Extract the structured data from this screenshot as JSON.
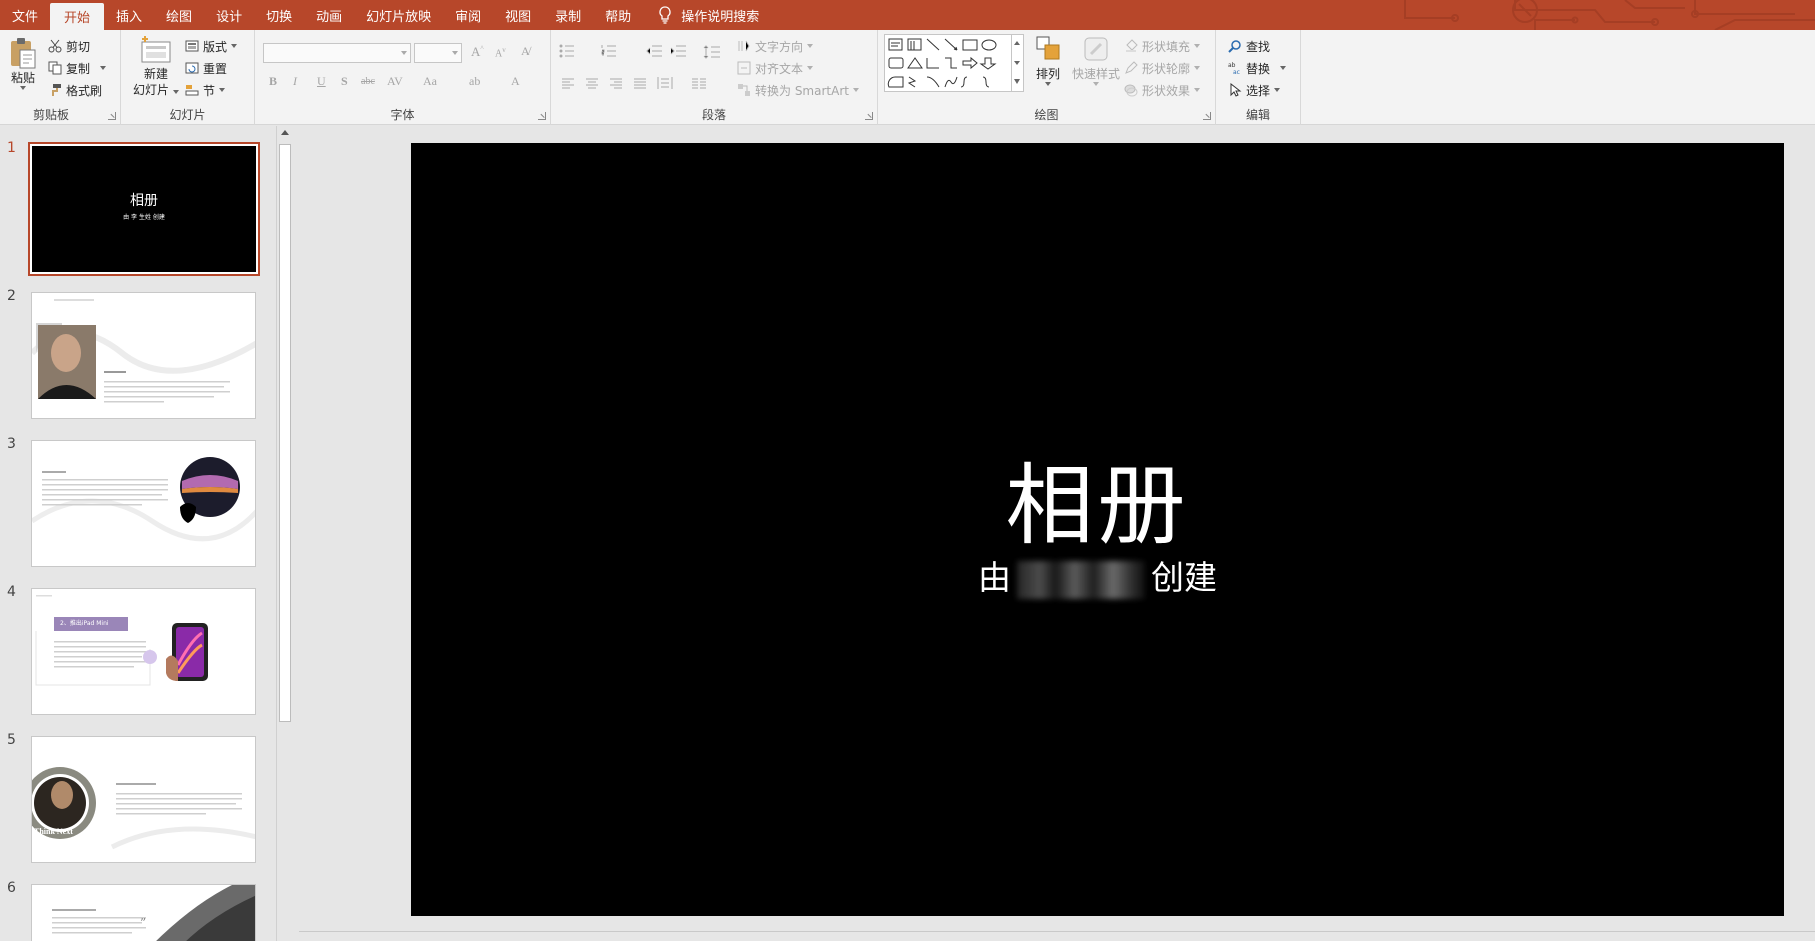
{
  "tabs": [
    {
      "label": "文件",
      "name": "tab-file"
    },
    {
      "label": "开始",
      "name": "tab-home",
      "active": true
    },
    {
      "label": "插入",
      "name": "tab-insert"
    },
    {
      "label": "绘图",
      "name": "tab-draw"
    },
    {
      "label": "设计",
      "name": "tab-design"
    },
    {
      "label": "切换",
      "name": "tab-transitions"
    },
    {
      "label": "动画",
      "name": "tab-animations"
    },
    {
      "label": "幻灯片放映",
      "name": "tab-slideshow"
    },
    {
      "label": "审阅",
      "name": "tab-review"
    },
    {
      "label": "视图",
      "name": "tab-view"
    },
    {
      "label": "录制",
      "name": "tab-record"
    },
    {
      "label": "帮助",
      "name": "tab-help"
    }
  ],
  "search_label": "操作说明搜索",
  "clipboard": {
    "label": "剪贴板",
    "paste": "粘贴",
    "cut": "剪切",
    "copy": "复制",
    "format_painter": "格式刷"
  },
  "slides_group": {
    "label": "幻灯片",
    "new_slide_1": "新建",
    "new_slide_2": "幻灯片",
    "layout": "版式",
    "reset": "重置",
    "section": "节"
  },
  "font_group": {
    "label": "字体"
  },
  "paragraph_group": {
    "label": "段落",
    "text_direction": "文字方向",
    "align_text": "对齐文本",
    "smartart": "转换为 SmartArt"
  },
  "drawing_group": {
    "label": "绘图",
    "arrange": "排列",
    "quick_styles": "快速样式",
    "shape_fill": "形状填充",
    "shape_outline": "形状轮廓",
    "shape_effects": "形状效果"
  },
  "editing_group": {
    "label": "编辑",
    "find": "查找",
    "replace": "替换",
    "select": "选择"
  },
  "thumbnails": [
    {
      "num": "1",
      "title": "相册",
      "sub": "由 李 生姓 创建"
    },
    {
      "num": "2"
    },
    {
      "num": "3"
    },
    {
      "num": "4",
      "chip": "2、推出iPad Mini"
    },
    {
      "num": "5",
      "badge": "Think Next"
    },
    {
      "num": "6"
    }
  ],
  "slide": {
    "title": "相册",
    "sub_prefix": "由",
    "sub_suffix": "创建"
  },
  "colors": {
    "accent": "#b7472a",
    "ribbon_bg": "#f3f3f3",
    "slide_bg": "#000000"
  }
}
